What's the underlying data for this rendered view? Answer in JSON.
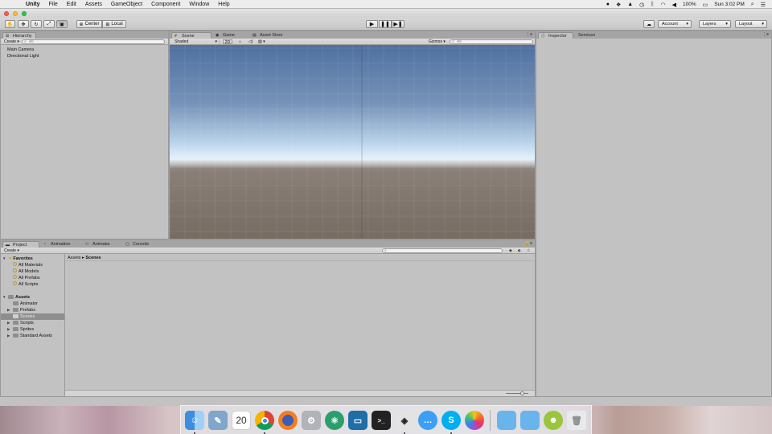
{
  "menubar": {
    "apple_icon": "",
    "items": [
      "Unity",
      "File",
      "Edit",
      "Assets",
      "GameObject",
      "Component",
      "Window",
      "Help"
    ],
    "battery": "100%",
    "clock": "Sun 3:02 PM",
    "status_icons": [
      "bluetooth-icon",
      "dropbox-icon",
      "drive-icon",
      "time-machine-icon",
      "bluetooth-b-icon",
      "wifi-icon",
      "volume-icon",
      "battery-icon",
      "spotlight-icon",
      "notifications-icon"
    ]
  },
  "toolbar": {
    "pivot_label": "Center",
    "space_label": "Local",
    "account_label": "Account",
    "layers_label": "Layers",
    "layout_label": "Layout"
  },
  "hierarchy": {
    "tab": "Hierarchy",
    "create_label": "Create",
    "search_placeholder": "All",
    "items": [
      "Main Camera",
      "Directional Light"
    ]
  },
  "scene": {
    "tabs": [
      "Scene",
      "Game",
      "Asset Store"
    ],
    "shading": "Shaded",
    "mode_2d": "2D",
    "gizmos_label": "Gizmos",
    "search_placeholder": "All"
  },
  "inspector": {
    "tabs": [
      "Inspector",
      "Services"
    ]
  },
  "project": {
    "tabs": [
      "Project",
      "Animation",
      "Animator",
      "Console"
    ],
    "create_label": "Create",
    "breadcrumb": [
      "Assets",
      "Scenes"
    ],
    "favorites_label": "Favorites",
    "favorites": [
      "All Materials",
      "All Models",
      "All Prefabs",
      "All Scripts"
    ],
    "assets_label": "Assets",
    "folders": [
      "Animator",
      "Prefabs",
      "Scenes",
      "Scripts",
      "Sprites",
      "Standard Assets"
    ],
    "selected_folder": "Scenes"
  },
  "dock": {
    "apps": [
      "finder-icon",
      "preview-icon",
      "calendar-icon",
      "chrome-icon",
      "firefox-icon",
      "system-preferences-icon",
      "atom-icon",
      "screen-sharing-icon",
      "terminal-icon",
      "unity-icon",
      "messages-icon",
      "skype-icon",
      "photos-icon",
      "documents-folder-icon",
      "downloads-folder-icon",
      "android-studio-icon",
      "trash-icon"
    ],
    "calendar_day": "20"
  }
}
